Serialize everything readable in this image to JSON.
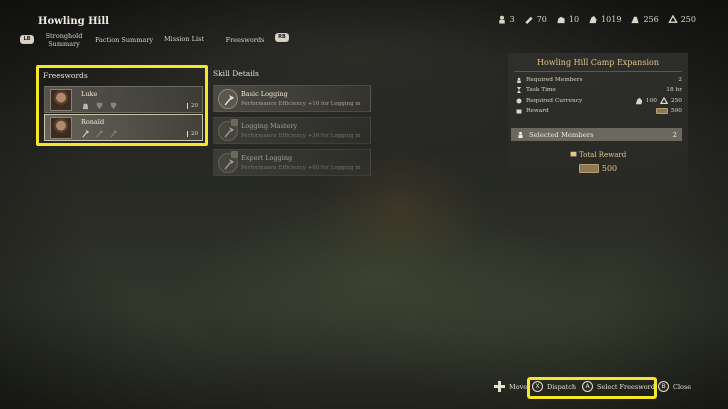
{
  "header": {
    "title": "Howling Hill",
    "resources": [
      {
        "icon": "soldier-icon",
        "value": "3"
      },
      {
        "icon": "wood-icon",
        "value": "70"
      },
      {
        "icon": "stone-icon",
        "value": "10"
      },
      {
        "icon": "ore-icon",
        "value": "1019"
      },
      {
        "icon": "grain-icon",
        "value": "256"
      },
      {
        "icon": "gold-icon",
        "value": "250"
      }
    ]
  },
  "tabs": {
    "left_bumper": "LB",
    "right_bumper": "RB",
    "items": [
      {
        "label": "Stronghold\nSummary"
      },
      {
        "label": "Faction Summary"
      },
      {
        "label": "Mission List"
      },
      {
        "label": "Freeswords"
      }
    ]
  },
  "freeswords": {
    "title": "Freeswords",
    "members": [
      {
        "name": "Luke",
        "level": "20",
        "skill_icons": [
          "grain-sack-icon",
          "shield-icon",
          "shield-icon"
        ]
      },
      {
        "name": "Ronald",
        "level": "20",
        "skill_icons": [
          "axe-icon",
          "axe-icon",
          "axe-icon"
        ]
      }
    ]
  },
  "skill_details": {
    "title": "Skill Details",
    "skills": [
      {
        "name": "Basic Logging",
        "desc": "Performance Efficiency +10 for Logging m"
      },
      {
        "name": "Logging Mastery",
        "desc": "Performance Efficiency +30 for Logging m"
      },
      {
        "name": "Expert Logging",
        "desc": "Performance Efficiency +60 for Logging m"
      }
    ]
  },
  "mission": {
    "title": "Howling Hill Camp Expansion",
    "required_members_label": "Required Members",
    "required_members_value": "2",
    "task_time_label": "Task Time",
    "task_time_value": "18 hr",
    "required_currency_label": "Required Currency",
    "required_currency_value_1": "100",
    "required_currency_value_2": "250",
    "reward_label": "Reward",
    "reward_value": "500",
    "selected_members_label": "Selected Members",
    "selected_members_value": "2",
    "total_reward_label": "Total Reward",
    "total_reward_value": "500"
  },
  "prompts": {
    "move": "Move",
    "dispatch_button": "X",
    "dispatch": "Dispatch",
    "select_button": "A",
    "select": "Select Freesword",
    "close_button": "B",
    "close": "Close"
  },
  "colors": {
    "highlight": "#f5e62a",
    "gold_text": "#e3c68a"
  }
}
